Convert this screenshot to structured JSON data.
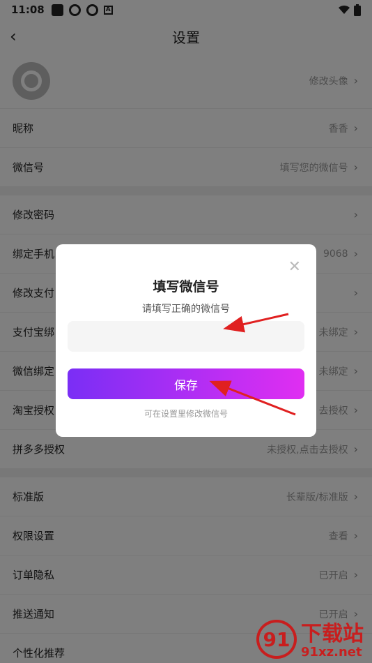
{
  "status": {
    "time": "11:08"
  },
  "header": {
    "title": "设置",
    "back_icon": "chevron-left-icon"
  },
  "rows": {
    "avatar": {
      "value": "修改头像"
    },
    "nickname": {
      "label": "昵称",
      "value": "香香"
    },
    "wechat": {
      "label": "微信号",
      "value": "填写您的微信号"
    },
    "password": {
      "label": "修改密码"
    },
    "phone": {
      "label": "绑定手机",
      "value": "9068"
    },
    "paypwd": {
      "label": "修改支付"
    },
    "alipay": {
      "label": "支付宝绑",
      "value": "未绑定"
    },
    "wxbind": {
      "label": "微信绑定",
      "value": "未绑定"
    },
    "taobao": {
      "label": "淘宝授权",
      "value": "去授权"
    },
    "pdd": {
      "label": "拼多多授权",
      "value": "未授权,点击去授权"
    },
    "edition": {
      "label": "标准版",
      "value": "长辈版/标准版"
    },
    "perm": {
      "label": "权限设置",
      "value": "查看"
    },
    "privacy": {
      "label": "订单隐私",
      "value": "已开启"
    },
    "push": {
      "label": "推送通知",
      "value": "已开启"
    },
    "recommend": {
      "label": "个性化推荐"
    }
  },
  "dialog": {
    "title": "填写微信号",
    "subtitle": "请填写正确的微信号",
    "input_value": "",
    "save_label": "保存",
    "hint": "可在设置里修改微信号",
    "close_icon": "close-icon"
  },
  "colors": {
    "accent_start": "#7a2ef5",
    "accent_end": "#e02ef2",
    "annotation_red": "#e02020"
  },
  "watermark": {
    "top": "下载站",
    "bottom": "91xz.net",
    "logo": "91"
  }
}
